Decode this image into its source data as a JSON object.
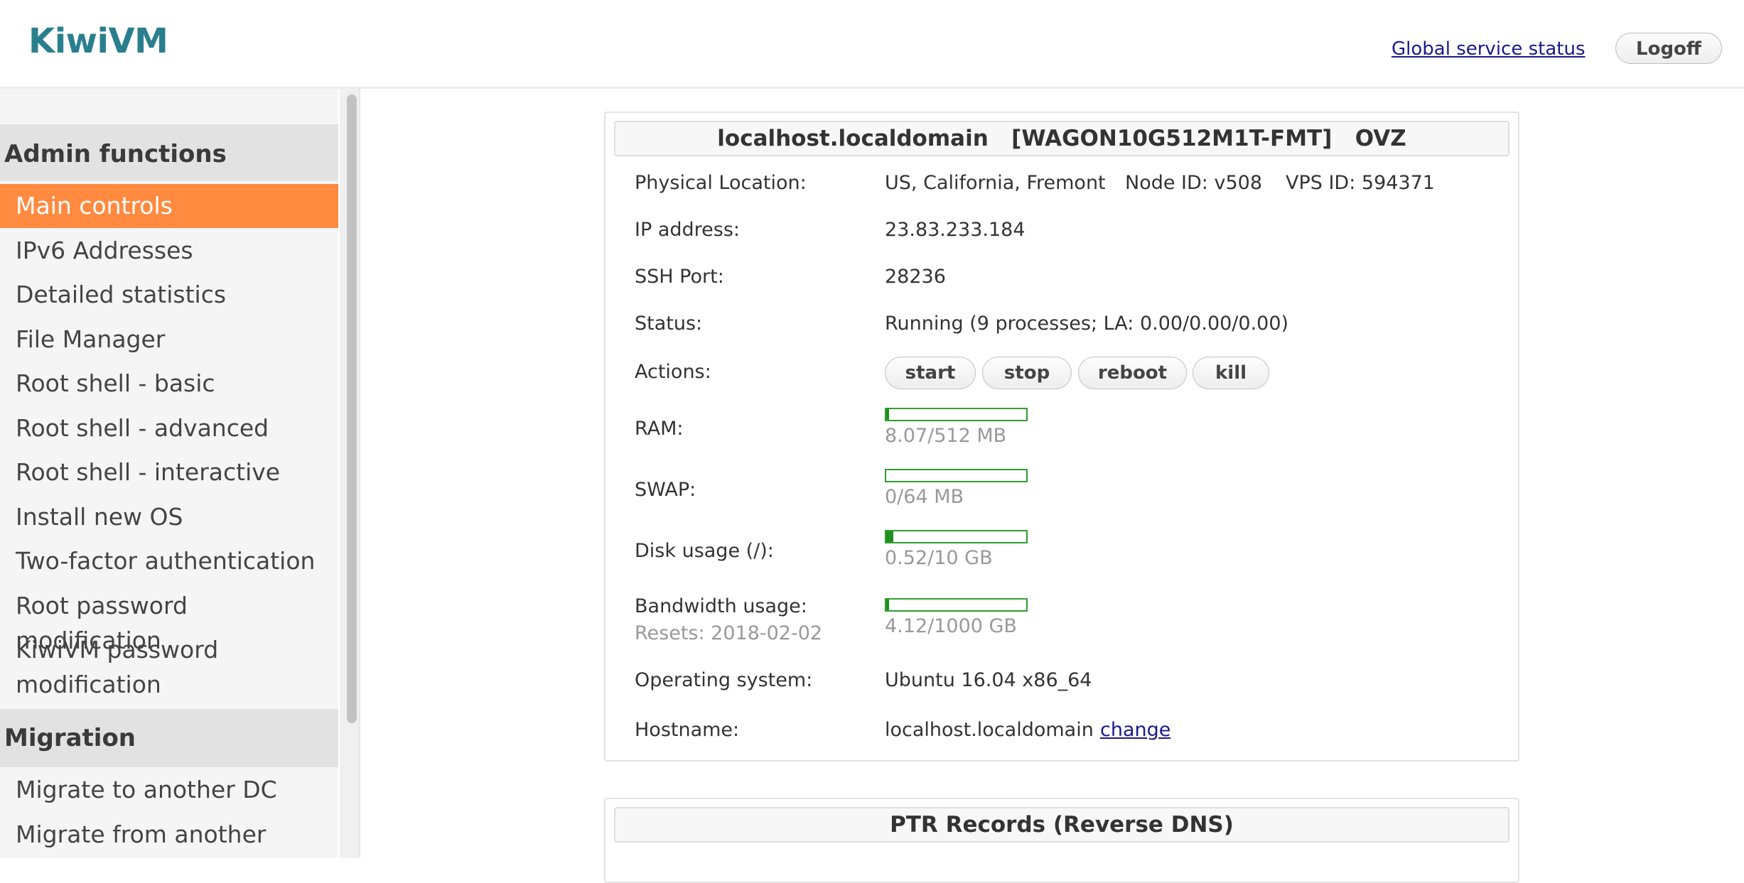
{
  "header": {
    "logo": "KiwiVM",
    "global_status_link": "Global service status",
    "logoff_label": "Logoff"
  },
  "sidebar": {
    "sections": [
      {
        "title": "Admin functions",
        "items": [
          {
            "label": "Main controls",
            "active": true
          },
          {
            "label": "IPv6 Addresses"
          },
          {
            "label": "Detailed statistics"
          },
          {
            "label": "File Manager"
          },
          {
            "label": "Root shell - basic"
          },
          {
            "label": "Root shell - advanced"
          },
          {
            "label": "Root shell - interactive"
          },
          {
            "label": "Install new OS"
          },
          {
            "label": "Two-factor authentication"
          },
          {
            "label": "Root password modification"
          },
          {
            "label": "KiwiVM password"
          },
          {
            "label": "modification"
          }
        ]
      },
      {
        "title": "Migration",
        "items": [
          {
            "label": "Migrate to another DC"
          },
          {
            "label": "Migrate from another"
          }
        ]
      }
    ]
  },
  "main": {
    "panel_title": "localhost.localdomain   [WAGON10G512M1T-FMT]   OVZ",
    "location": {
      "label": "Physical Location:",
      "value": "US, California, Fremont",
      "node_id": "Node ID: v508",
      "vps_id": "VPS ID: 594371"
    },
    "ip": {
      "label": "IP address:",
      "value": "23.83.233.184"
    },
    "ssh": {
      "label": "SSH Port:",
      "value": "28236"
    },
    "status": {
      "label": "Status:",
      "value": "Running (9 processes; LA: 0.00/0.00/0.00)"
    },
    "actions": {
      "label": "Actions:",
      "start": "start",
      "stop": "stop",
      "reboot": "reboot",
      "kill": "kill"
    },
    "ram": {
      "label": "RAM:",
      "value": "8.07/512 MB",
      "used_fraction": 0.016
    },
    "swap": {
      "label": "SWAP:",
      "value": "0/64 MB",
      "used_fraction": 0.0
    },
    "disk": {
      "label": "Disk usage (/):",
      "value": "0.52/10 GB",
      "used_fraction": 0.052
    },
    "bandwidth": {
      "label": "Bandwidth usage:",
      "resets": "Resets: 2018-02-02",
      "value": "4.12/1000 GB",
      "used_fraction": 0.004
    },
    "os": {
      "label": "Operating system:",
      "value": "Ubuntu 16.04 x86_64"
    },
    "hostname": {
      "label": "Hostname:",
      "value": "localhost.localdomain",
      "change_link": "change"
    },
    "ptr_title": "PTR Records (Reverse DNS)"
  },
  "colors": {
    "accent_active": "#ff8a40",
    "bar_green": "#1f8f1f",
    "link": "#1a1a8c",
    "logo": "#2a7f8f"
  }
}
